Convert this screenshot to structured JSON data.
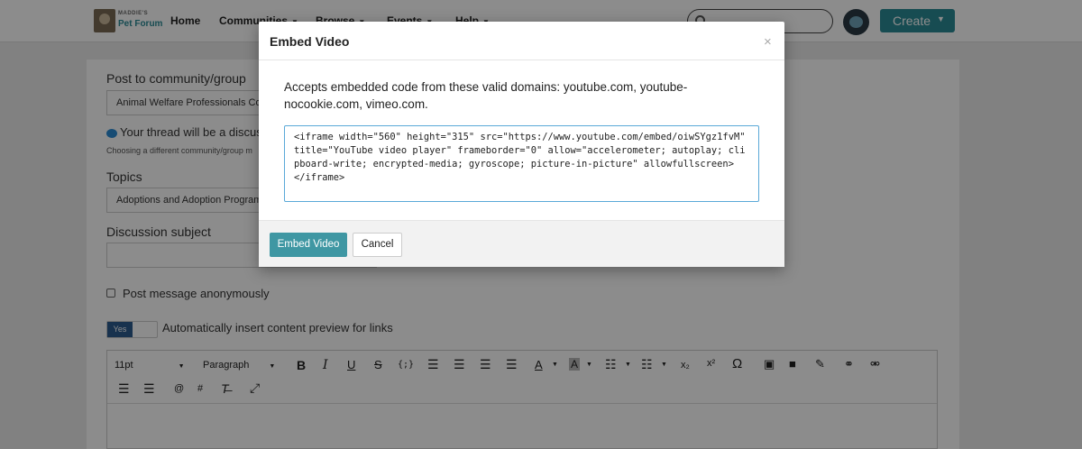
{
  "header": {
    "logo_small": "MADDIE'S",
    "logo_text": "Pet Forum",
    "nav": [
      {
        "label": "Home"
      },
      {
        "label": "Communities"
      },
      {
        "label": "Browse"
      },
      {
        "label": "Events"
      },
      {
        "label": "Help"
      }
    ],
    "create_label": "Create"
  },
  "form": {
    "post_to_label": "Post to community/group",
    "post_to_value": "Animal Welfare Professionals Co",
    "thread_note": "Your thread will be a discuss",
    "thread_subnote": "Choosing a different community/group m",
    "topics_label": "Topics",
    "topics_value": "Adoptions and Adoption Program",
    "subject_label": "Discussion subject",
    "subject_value": "",
    "anon_label": "Post message anonymously",
    "preview_toggle_label": "Yes",
    "preview_label": "Automatically insert content preview for links"
  },
  "editor": {
    "font_size": "11pt",
    "block_format": "Paragraph"
  },
  "modal": {
    "title": "Embed Video",
    "close": "×",
    "description": "Accepts embedded code from these valid domains: youtube.com, youtube-nocookie.com, vimeo.com.",
    "code": "<iframe width=\"560\" height=\"315\" src=\"https://www.youtube.com/embed/oiwSYgz1fvM\" title=\"YouTube video player\" frameborder=\"0\" allow=\"accelerometer; autoplay; clipboard-write; encrypted-media; gyroscope; picture-in-picture\" allowfullscreen>\n</iframe>",
    "submit_label": "Embed Video",
    "cancel_label": "Cancel"
  }
}
